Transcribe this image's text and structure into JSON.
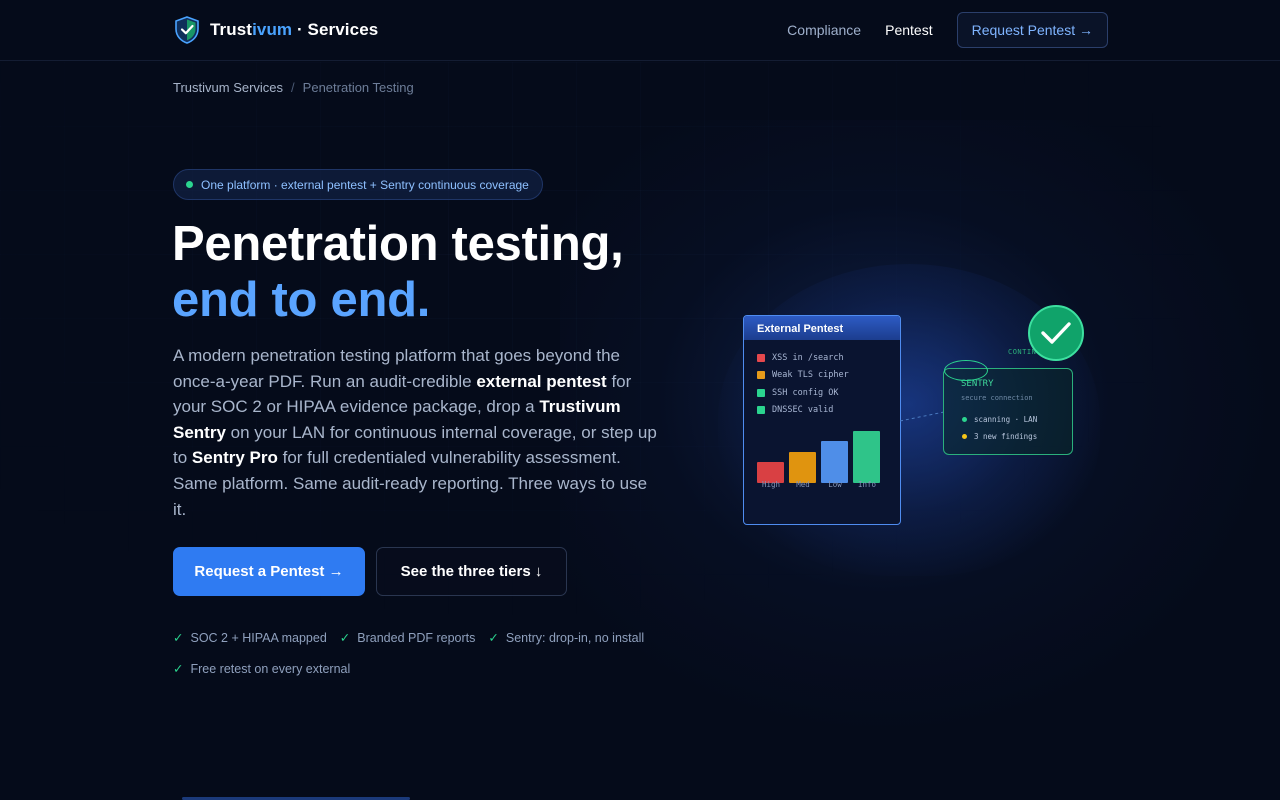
{
  "nav": {
    "brand": {
      "pre": "Trust",
      "highlight": "ivum",
      "post": " · Services"
    },
    "links": [
      "Compliance",
      "Pentest"
    ],
    "cta": "Request Pentest →"
  },
  "breadcrumb": {
    "root": "Trustivum Services",
    "separator": "/",
    "current": "Penetration Testing"
  },
  "hero": {
    "pill": "One platform · external pentest + Sentry continuous coverage",
    "title_line1": "Penetration testing,",
    "title_line2": "end to end.",
    "lede": {
      "p1": "A modern penetration testing platform that goes beyond the once-a-year PDF. Run an audit-credible ",
      "b1": "external pentest",
      "p2": " for your SOC 2 or HIPAA evidence package, drop a ",
      "b2": "Trustivum Sentry",
      "p3": " on your LAN for continuous internal coverage, or step up to ",
      "b3": "Sentry Pro",
      "p4": " for full credentialed vulnerability assessment. Same platform. Same audit-ready reporting. Three ways to use it."
    },
    "primary_button": "Request a Pentest →",
    "secondary_button": "See the three tiers ↓",
    "checks": [
      "SOC 2 + HIPAA mapped",
      "Branded PDF reports",
      "Sentry: drop-in, no install",
      "Free retest on every external"
    ],
    "check_glyph": "✓"
  },
  "illustration": {
    "external_card": {
      "title": "External Pentest",
      "findings": [
        {
          "text": "XSS in /search",
          "color": "#e5484d"
        },
        {
          "text": "Weak TLS cipher",
          "color": "#e59a1a"
        },
        {
          "text": "SSH config OK",
          "color": "#2bd48f"
        },
        {
          "text": "DNSSEC valid",
          "color": "#2bd48f"
        }
      ]
    },
    "chart_data": {
      "type": "bar",
      "categories": [
        "High",
        "Med",
        "Low",
        "Info"
      ],
      "values": [
        2,
        3,
        4,
        5
      ],
      "colors": [
        "#d94043",
        "#e0940f",
        "#4f8ee8",
        "#2fc489"
      ]
    },
    "sentry_card": {
      "tag": "CONTIN",
      "title": "SENTRY",
      "subtitle": "secure connection",
      "status": [
        {
          "text": "scanning · LAN",
          "color": "#2bd48f"
        },
        {
          "text": "3 new findings",
          "color": "#f5c518"
        }
      ]
    }
  }
}
